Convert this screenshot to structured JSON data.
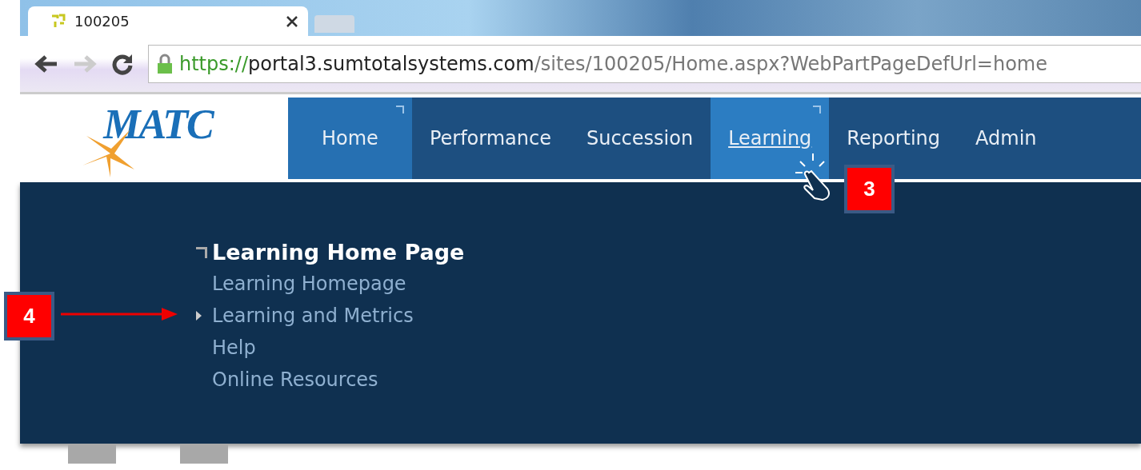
{
  "browser": {
    "tab_title": "100205",
    "url": {
      "scheme": "https://",
      "host": "portal3.sumtotalsystems.com",
      "path": "/sites/100205/Home.aspx?WebPartPageDefUrl=home"
    }
  },
  "logo": {
    "text": "MATC"
  },
  "nav": [
    {
      "label": "Home",
      "selected": true,
      "hovered": false
    },
    {
      "label": "Performance",
      "selected": false,
      "hovered": false
    },
    {
      "label": "Succession",
      "selected": false,
      "hovered": false
    },
    {
      "label": "Learning",
      "selected": false,
      "hovered": true
    },
    {
      "label": "Reporting",
      "selected": false,
      "hovered": false
    },
    {
      "label": "Admin",
      "selected": false,
      "hovered": false
    }
  ],
  "menu": {
    "heading": "Learning Home Page",
    "items": [
      {
        "label": "Learning Homepage",
        "pointed": false
      },
      {
        "label": "Learning and Metrics",
        "pointed": true
      },
      {
        "label": "Help",
        "pointed": false
      },
      {
        "label": "Online Resources",
        "pointed": false
      }
    ]
  },
  "callouts": [
    {
      "label": "3"
    },
    {
      "label": "4"
    }
  ]
}
